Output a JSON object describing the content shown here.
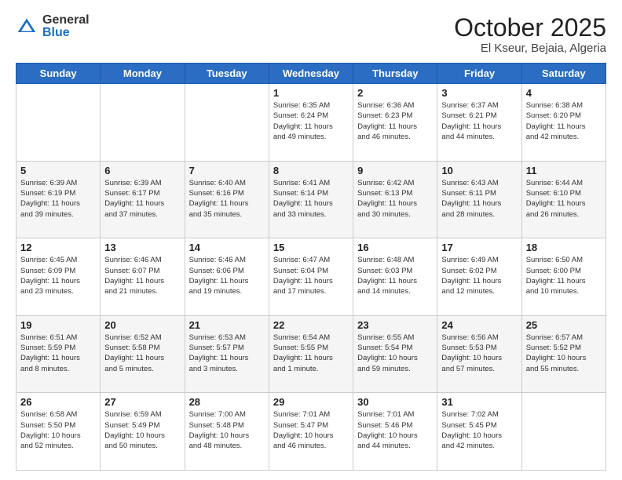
{
  "header": {
    "logo_general": "General",
    "logo_blue": "Blue",
    "month_title": "October 2025",
    "location": "El Kseur, Bejaia, Algeria"
  },
  "days_of_week": [
    "Sunday",
    "Monday",
    "Tuesday",
    "Wednesday",
    "Thursday",
    "Friday",
    "Saturday"
  ],
  "weeks": [
    [
      {
        "day": "",
        "info": ""
      },
      {
        "day": "",
        "info": ""
      },
      {
        "day": "",
        "info": ""
      },
      {
        "day": "1",
        "info": "Sunrise: 6:35 AM\nSunset: 6:24 PM\nDaylight: 11 hours\nand 49 minutes."
      },
      {
        "day": "2",
        "info": "Sunrise: 6:36 AM\nSunset: 6:23 PM\nDaylight: 11 hours\nand 46 minutes."
      },
      {
        "day": "3",
        "info": "Sunrise: 6:37 AM\nSunset: 6:21 PM\nDaylight: 11 hours\nand 44 minutes."
      },
      {
        "day": "4",
        "info": "Sunrise: 6:38 AM\nSunset: 6:20 PM\nDaylight: 11 hours\nand 42 minutes."
      }
    ],
    [
      {
        "day": "5",
        "info": "Sunrise: 6:39 AM\nSunset: 6:19 PM\nDaylight: 11 hours\nand 39 minutes."
      },
      {
        "day": "6",
        "info": "Sunrise: 6:39 AM\nSunset: 6:17 PM\nDaylight: 11 hours\nand 37 minutes."
      },
      {
        "day": "7",
        "info": "Sunrise: 6:40 AM\nSunset: 6:16 PM\nDaylight: 11 hours\nand 35 minutes."
      },
      {
        "day": "8",
        "info": "Sunrise: 6:41 AM\nSunset: 6:14 PM\nDaylight: 11 hours\nand 33 minutes."
      },
      {
        "day": "9",
        "info": "Sunrise: 6:42 AM\nSunset: 6:13 PM\nDaylight: 11 hours\nand 30 minutes."
      },
      {
        "day": "10",
        "info": "Sunrise: 6:43 AM\nSunset: 6:11 PM\nDaylight: 11 hours\nand 28 minutes."
      },
      {
        "day": "11",
        "info": "Sunrise: 6:44 AM\nSunset: 6:10 PM\nDaylight: 11 hours\nand 26 minutes."
      }
    ],
    [
      {
        "day": "12",
        "info": "Sunrise: 6:45 AM\nSunset: 6:09 PM\nDaylight: 11 hours\nand 23 minutes."
      },
      {
        "day": "13",
        "info": "Sunrise: 6:46 AM\nSunset: 6:07 PM\nDaylight: 11 hours\nand 21 minutes."
      },
      {
        "day": "14",
        "info": "Sunrise: 6:46 AM\nSunset: 6:06 PM\nDaylight: 11 hours\nand 19 minutes."
      },
      {
        "day": "15",
        "info": "Sunrise: 6:47 AM\nSunset: 6:04 PM\nDaylight: 11 hours\nand 17 minutes."
      },
      {
        "day": "16",
        "info": "Sunrise: 6:48 AM\nSunset: 6:03 PM\nDaylight: 11 hours\nand 14 minutes."
      },
      {
        "day": "17",
        "info": "Sunrise: 6:49 AM\nSunset: 6:02 PM\nDaylight: 11 hours\nand 12 minutes."
      },
      {
        "day": "18",
        "info": "Sunrise: 6:50 AM\nSunset: 6:00 PM\nDaylight: 11 hours\nand 10 minutes."
      }
    ],
    [
      {
        "day": "19",
        "info": "Sunrise: 6:51 AM\nSunset: 5:59 PM\nDaylight: 11 hours\nand 8 minutes."
      },
      {
        "day": "20",
        "info": "Sunrise: 6:52 AM\nSunset: 5:58 PM\nDaylight: 11 hours\nand 5 minutes."
      },
      {
        "day": "21",
        "info": "Sunrise: 6:53 AM\nSunset: 5:57 PM\nDaylight: 11 hours\nand 3 minutes."
      },
      {
        "day": "22",
        "info": "Sunrise: 6:54 AM\nSunset: 5:55 PM\nDaylight: 11 hours\nand 1 minute."
      },
      {
        "day": "23",
        "info": "Sunrise: 6:55 AM\nSunset: 5:54 PM\nDaylight: 10 hours\nand 59 minutes."
      },
      {
        "day": "24",
        "info": "Sunrise: 6:56 AM\nSunset: 5:53 PM\nDaylight: 10 hours\nand 57 minutes."
      },
      {
        "day": "25",
        "info": "Sunrise: 6:57 AM\nSunset: 5:52 PM\nDaylight: 10 hours\nand 55 minutes."
      }
    ],
    [
      {
        "day": "26",
        "info": "Sunrise: 6:58 AM\nSunset: 5:50 PM\nDaylight: 10 hours\nand 52 minutes."
      },
      {
        "day": "27",
        "info": "Sunrise: 6:59 AM\nSunset: 5:49 PM\nDaylight: 10 hours\nand 50 minutes."
      },
      {
        "day": "28",
        "info": "Sunrise: 7:00 AM\nSunset: 5:48 PM\nDaylight: 10 hours\nand 48 minutes."
      },
      {
        "day": "29",
        "info": "Sunrise: 7:01 AM\nSunset: 5:47 PM\nDaylight: 10 hours\nand 46 minutes."
      },
      {
        "day": "30",
        "info": "Sunrise: 7:01 AM\nSunset: 5:46 PM\nDaylight: 10 hours\nand 44 minutes."
      },
      {
        "day": "31",
        "info": "Sunrise: 7:02 AM\nSunset: 5:45 PM\nDaylight: 10 hours\nand 42 minutes."
      },
      {
        "day": "",
        "info": ""
      }
    ]
  ]
}
